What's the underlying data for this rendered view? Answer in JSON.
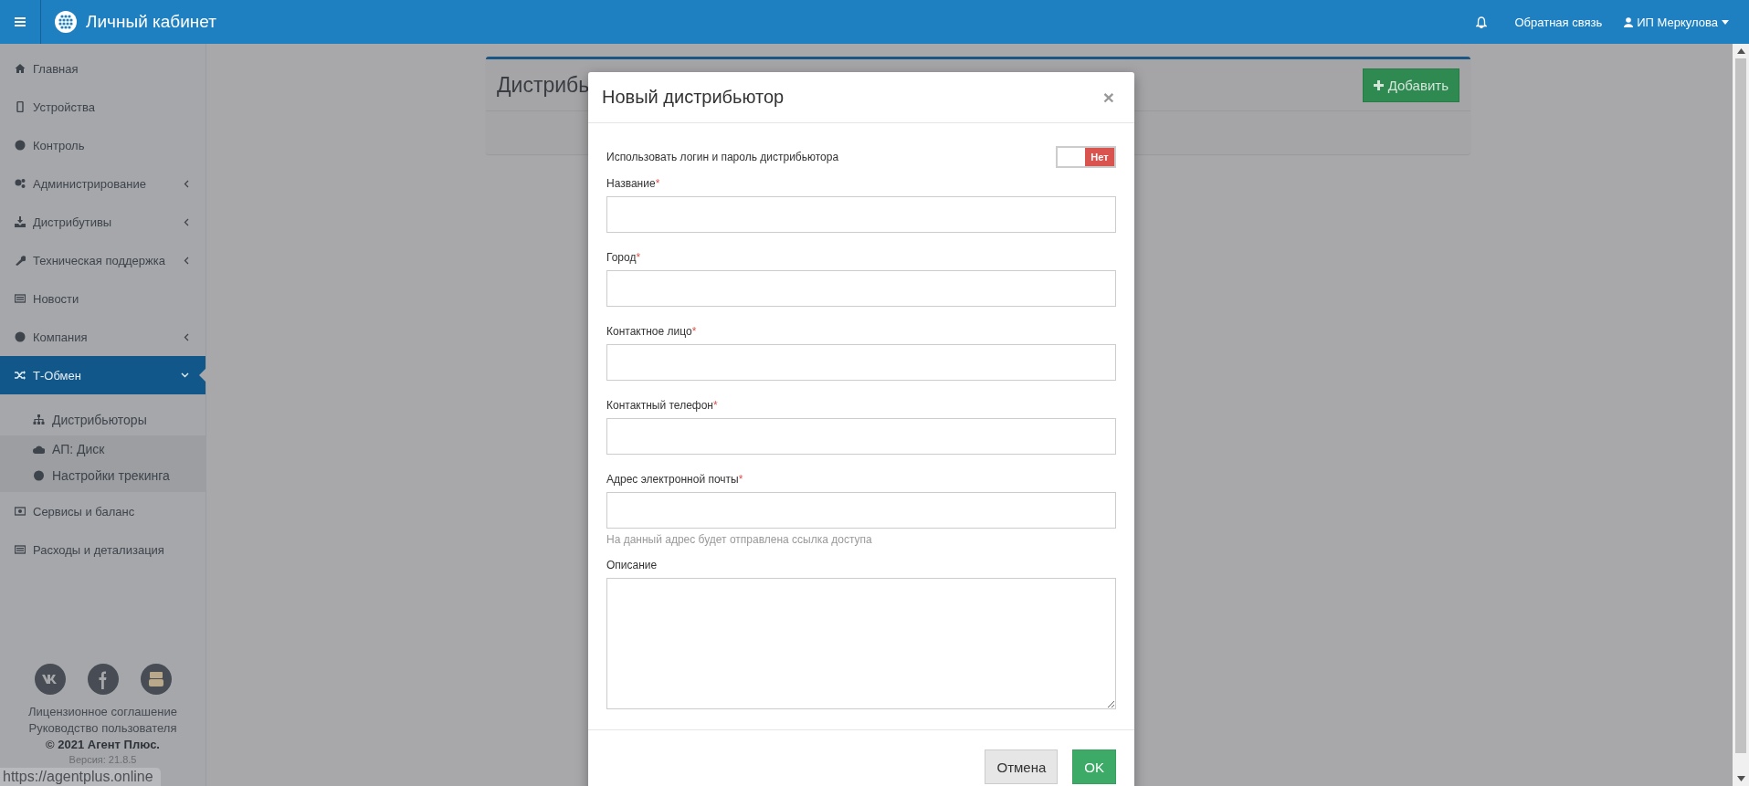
{
  "topbar": {
    "title": "Личный кабинет",
    "feedback": "Обратная связь",
    "user": "ИП Меркулова"
  },
  "sidebar": {
    "items": [
      {
        "label": "Главная",
        "selected": false
      },
      {
        "label": "Устройства",
        "selected": false
      },
      {
        "label": "Контроль",
        "selected": false
      },
      {
        "label": "Администрирование",
        "selected": false,
        "expanded": false
      },
      {
        "label": "Дистрибутивы",
        "selected": false,
        "expanded": false
      },
      {
        "label": "Техническая поддержка",
        "selected": false,
        "expanded": false
      },
      {
        "label": "Новости",
        "selected": false
      },
      {
        "label": "Компания",
        "selected": false,
        "expanded": false
      },
      {
        "label": "Т-Обмен",
        "selected": true,
        "expanded": true,
        "children": [
          {
            "label": "Дистрибьюторы",
            "selected": true
          },
          {
            "label": "АП: Диск",
            "selected": false
          },
          {
            "label": "Настройки трекинга",
            "selected": false
          }
        ]
      },
      {
        "label": "Сервисы и баланс",
        "selected": false
      },
      {
        "label": "Расходы и детализация",
        "selected": false
      }
    ],
    "footer": {
      "links": [
        "Лицензионное соглашение",
        "Руководство пользователя"
      ],
      "copyright": "© 2021 Агент Плюс.",
      "version": "Версия: 21.8.5"
    }
  },
  "page": {
    "title": "Дистрибь",
    "add_button": "Добавить"
  },
  "modal": {
    "title": "Новый дистрибьютор",
    "close": "×",
    "required_mark": "*",
    "toggle": {
      "label": "Использовать логин и пароль дистрибьютора",
      "on": false,
      "state_label": "Нет"
    },
    "fields": [
      {
        "label": "Название",
        "required": true,
        "kind": "input"
      },
      {
        "label": "Город",
        "required": true,
        "kind": "input"
      },
      {
        "label": "Контактное лицо",
        "required": true,
        "kind": "input"
      },
      {
        "label": "Контактный телефон",
        "required": true,
        "kind": "input"
      },
      {
        "label": "Адрес электронной почты",
        "required": true,
        "kind": "input",
        "help": "На данный адрес будет отправлена ссылка доступа"
      },
      {
        "label": "Описание",
        "required": false,
        "kind": "textarea"
      }
    ],
    "buttons": [
      {
        "label": "Отмена",
        "kind": "default"
      },
      {
        "label": "OK",
        "kind": "primary"
      }
    ]
  },
  "status_url": "https://agentplus.online"
}
